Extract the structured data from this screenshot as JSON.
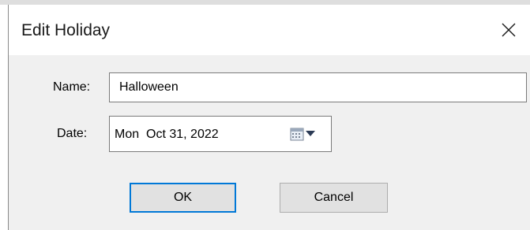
{
  "dialog": {
    "title": "Edit Holiday",
    "close_icon": "close-icon"
  },
  "form": {
    "name_label": "Name:",
    "name_value": "Halloween",
    "date_label": "Date:",
    "date_value": "Mon  Oct 31, 2022",
    "calendar_icon": "calendar-icon",
    "dropdown_icon": "chevron-down-icon"
  },
  "buttons": {
    "ok_label": "OK",
    "cancel_label": "Cancel"
  },
  "colors": {
    "dialog_background": "#f0f0f0",
    "title_bar": "#ffffff",
    "default_button_focus": "#0078d7"
  }
}
